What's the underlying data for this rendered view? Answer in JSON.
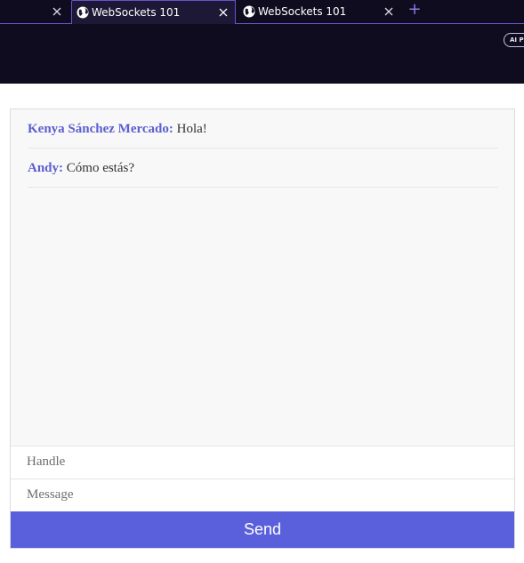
{
  "browser": {
    "tabs": [
      {
        "title": "",
        "state": "partial"
      },
      {
        "title": "WebSockets 101",
        "state": "active"
      },
      {
        "title": "WebSockets 101",
        "state": "inactive"
      }
    ],
    "ai_badge": "AI P"
  },
  "chat": {
    "messages": [
      {
        "handle": "Kenya Sánchez Mercado:",
        "text": " Hola!"
      },
      {
        "handle": "Andy:",
        "text": " Cómo estás?"
      }
    ],
    "handle_placeholder": "Handle",
    "message_placeholder": "Message",
    "send_label": "Send"
  },
  "colors": {
    "chrome_bg": "#0f0c20",
    "tab_accent": "#6a52c8",
    "handle_color": "#5a5fcf",
    "send_button": "#5a5fdc"
  }
}
